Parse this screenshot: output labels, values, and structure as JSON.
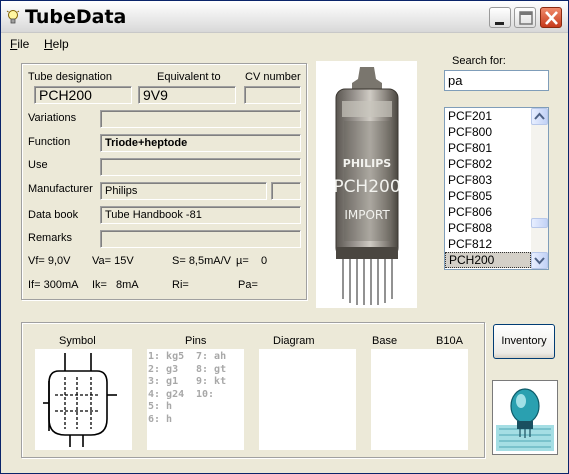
{
  "window": {
    "title": "TubeData"
  },
  "menu": {
    "file": "File",
    "help": "Help"
  },
  "details": {
    "tube_designation_label": "Tube designation",
    "equivalent_label": "Equivalent to",
    "cv_label": "CV number",
    "tube_designation": "PCH200",
    "equivalent": "9V9",
    "cv_number": "",
    "variations_label": "Variations",
    "variations": "",
    "function_label": "Function",
    "function": "Triode+heptode",
    "use_label": "Use",
    "use": "",
    "manufacturer_label": "Manufacturer",
    "manufacturer": "Philips",
    "manufacturer_extra": "",
    "databook_label": "Data book",
    "databook": "Tube Handbook -81",
    "remarks_label": "Remarks",
    "remarks": ""
  },
  "params": {
    "vf": "Vf= 9,0V",
    "va": "Va= 15V",
    "s": "S= 8,5mA/V",
    "mu": "µ=",
    "mu_val": "0",
    "if": "If= 300mA",
    "ik": "Ik=",
    "ik_val": "8mA",
    "ri": "Ri=",
    "pa": "Pa="
  },
  "photo": {
    "print_line1": "PHILIPS",
    "print_line2": "PCH200",
    "print_line3": "IMPORT"
  },
  "search": {
    "label": "Search for:",
    "value": "pa"
  },
  "tube_list": {
    "items": [
      "PCF201",
      "PCF800",
      "PCF801",
      "PCF802",
      "PCF803",
      "PCF805",
      "PCF806",
      "PCF808",
      "PCF812",
      "PCH200"
    ],
    "selected": "PCH200"
  },
  "bottom": {
    "symbol_label": "Symbol",
    "pins_label": "Pins",
    "diagram_label": "Diagram",
    "base_label": "Base",
    "base_value": "B10A",
    "pins_left": [
      "1: kg5",
      "2: g3",
      "3: g1",
      "4: g24",
      "5: h",
      "6: h"
    ],
    "pins_right": [
      "7: ah",
      "8: gt",
      "9: kt",
      "10:"
    ]
  },
  "buttons": {
    "inventory": "Inventory"
  },
  "colors": {
    "title_close": "#c63a1c",
    "selection": "#d4d0c8",
    "window_bg": "#ece9d8",
    "pin_text": "#a8a8a8"
  }
}
